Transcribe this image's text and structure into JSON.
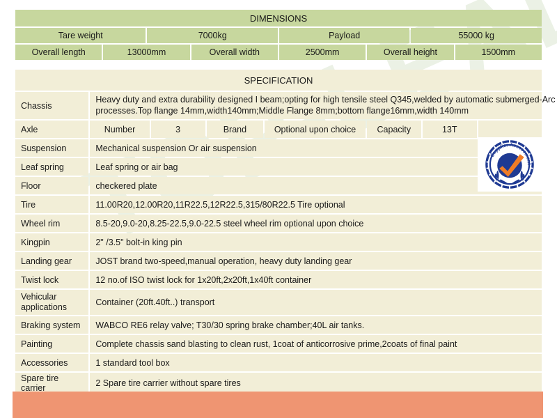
{
  "watermark": {
    "text": "TOP-LEAD"
  },
  "dimensions": {
    "title": "DIMENSIONS",
    "rows": [
      [
        {
          "label": "Tare weight",
          "span": 3
        },
        {
          "label": "7000kg",
          "span": 3
        },
        {
          "label": "Payload",
          "span": 3
        },
        {
          "label": "55000 kg",
          "span": 3
        }
      ],
      [
        {
          "label": "Overall length",
          "span": 2
        },
        {
          "label": "13000mm",
          "span": 2
        },
        {
          "label": "Overall width",
          "span": 2
        },
        {
          "label": "2500mm",
          "span": 2
        },
        {
          "label": "Overall height",
          "span": 2
        },
        {
          "label": "1500mm",
          "span": 2
        }
      ]
    ]
  },
  "specification": {
    "title": "SPECIFICATION",
    "rows": {
      "chassis": {
        "label": "Chassis",
        "line1": "Heavy duty and extra durability designed I beam;opting for high tensile steel Q345,welded by automatic submerged-Arc",
        "line2": "processes.Top flange 14mm,width140mm;Middle Flange 8mm;bottom flange16mm,width 140mm"
      },
      "axle": {
        "label": "Axle",
        "number_label": "Number",
        "number_value": "3",
        "brand_label": "Brand",
        "brand_value": "Optional upon choice",
        "capacity_label": "Capacity",
        "capacity_value": "13T",
        "empty": ""
      },
      "suspension": {
        "label": "Suspension",
        "value": "Mechanical suspension Or air suspension"
      },
      "leaf_spring": {
        "label": "Leaf spring",
        "value": "Leaf spring or air bag"
      },
      "floor": {
        "label": "Floor",
        "value": "checkered plate"
      },
      "tire": {
        "label": "Tire",
        "value": "11.00R20,12.00R20,11R22.5,12R22.5,315/80R22.5 Tire optional"
      },
      "wheel_rim": {
        "label": "Wheel rim",
        "value": "8.5-20,9.0-20,8.25-22.5,9.0-22.5 steel wheel rim optional upon choice"
      },
      "kingpin": {
        "label": "Kingpin",
        "value": "2\" /3.5\" bolt-in king pin"
      },
      "landing_gear": {
        "label": "Landing gear",
        "value": "JOST brand two-speed,manual operation, heavy duty landing gear"
      },
      "twist_lock": {
        "label": "Twist lock",
        "value": "12 no.of  ISO twist lock for 1x20ft,2x20ft,1x40ft container"
      },
      "vehicular_applications": {
        "label_line1": "Vehicular",
        "label_line2": "applications",
        "value": "Container (20ft.40ft..) transport"
      },
      "braking_system": {
        "label": "Braking system",
        "value": "WABCO RE6 relay valve; T30/30 spring brake chamber;40L air tanks."
      },
      "painting": {
        "label": "Painting",
        "value": "Complete chassis sand blasting to clean rust, 1coat of anticorrosive prime,2coats of final paint"
      },
      "accessories": {
        "label": "Accessories",
        "value": "1 standard tool box"
      },
      "spare_tire_carrier": {
        "label": "Spare tire carrier",
        "value": "2 Spare tire carrier without spare tires"
      }
    }
  },
  "badge": {
    "name": "supplier-assessment-seal",
    "text": "Supplier Assessment",
    "ring_color": "#1f3a93",
    "check_color": "#f07c26"
  },
  "colors": {
    "dimensions_cell": "#c7d79e",
    "specification_cell": "#f2eed7",
    "bottom_bar": "#ef9572",
    "page_background": "#ffffff",
    "text": "#1a1a1a"
  }
}
